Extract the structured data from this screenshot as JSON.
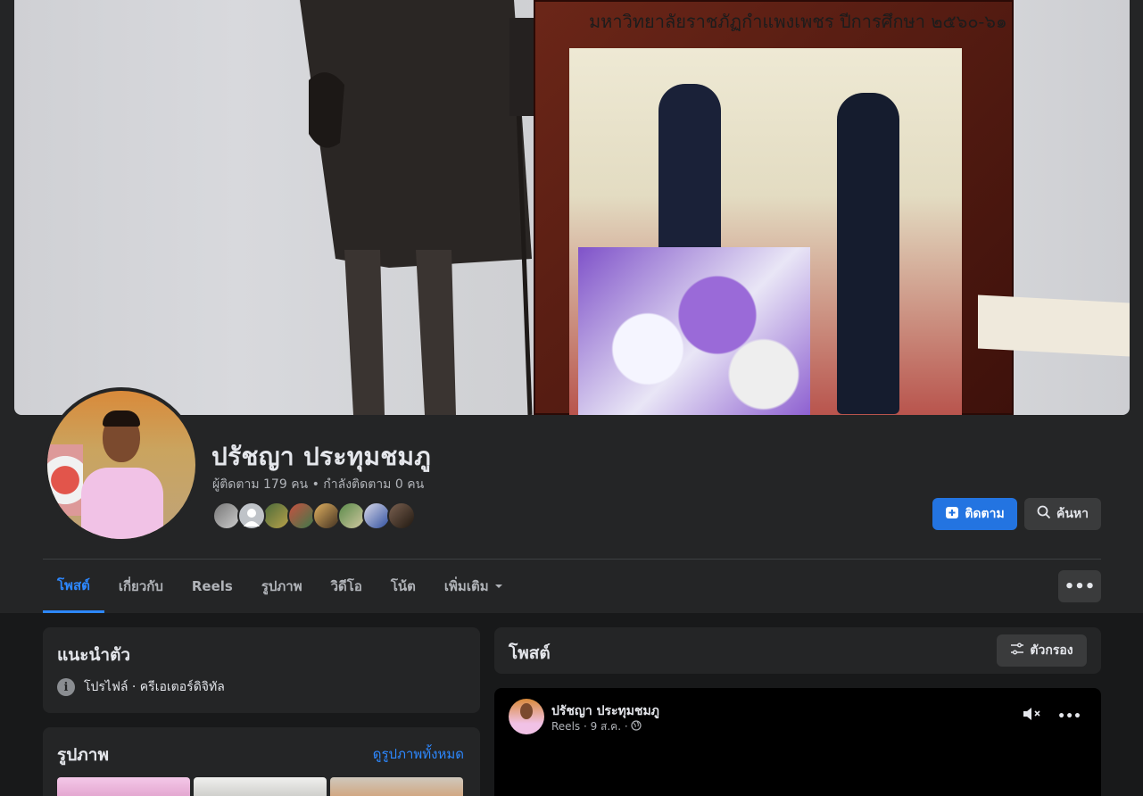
{
  "cover": {
    "frame_title": "มหาวิทยาลัยราชภัฏกำแพงเพชร ปีการศึกษา ๒๕๖๐-๖๑"
  },
  "profile": {
    "name": "ปรัชญา ประทุมชมภู",
    "followers_text": "ผู้ติดตาม 179 คน • กำลังติดตาม 0 คน",
    "follow_label": "ติดตาม",
    "search_label": "ค้นหา",
    "friend_count": 8
  },
  "tabs": [
    {
      "label": "โพสต์"
    },
    {
      "label": "เกี่ยวกับ"
    },
    {
      "label": "Reels"
    },
    {
      "label": "รูปภาพ"
    },
    {
      "label": "วิดีโอ"
    },
    {
      "label": "โน้ต"
    },
    {
      "label": "เพิ่มเติม"
    }
  ],
  "more_button": "•••",
  "intro": {
    "title": "แนะนำตัว",
    "info_icon": "i",
    "row": "โปรไฟล์ · ครีเอเตอร์ดิจิทัล"
  },
  "photos": {
    "title": "รูปภาพ",
    "see_all": "ดูรูปภาพทั้งหมด"
  },
  "posts": {
    "title": "โพสต์",
    "filter_label": "ตัวกรอง"
  },
  "reel": {
    "author": "ปรัชญา ประทุมชมภู",
    "meta": "Reels · 9 ส.ค. ·",
    "more": "•••"
  },
  "colors": {
    "accent": "#2d88ff",
    "follow_bg": "#2374e1",
    "card": "#242526",
    "page": "#18191a"
  }
}
